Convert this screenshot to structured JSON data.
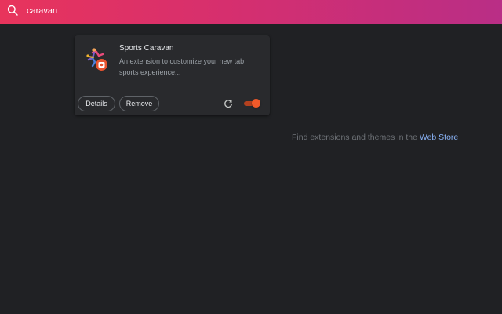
{
  "search": {
    "value": "caravan",
    "icon": "search-icon"
  },
  "extension": {
    "name": "Sports Caravan",
    "description": "An extension to customize your new tab sports experience...",
    "icon": "sports-caravan-icon",
    "enabled": true,
    "details_label": "Details",
    "remove_label": "Remove",
    "reload_icon": "reload-icon"
  },
  "store_hint": {
    "text": "Find extensions and themes in the",
    "link_label": "Web Store"
  },
  "colors": {
    "header_start": "#e8345c",
    "header_end": "#b92e86",
    "background": "#202124",
    "card": "#292a2d",
    "toggle_on": "#f05a2a",
    "link": "#8ab4f8"
  }
}
